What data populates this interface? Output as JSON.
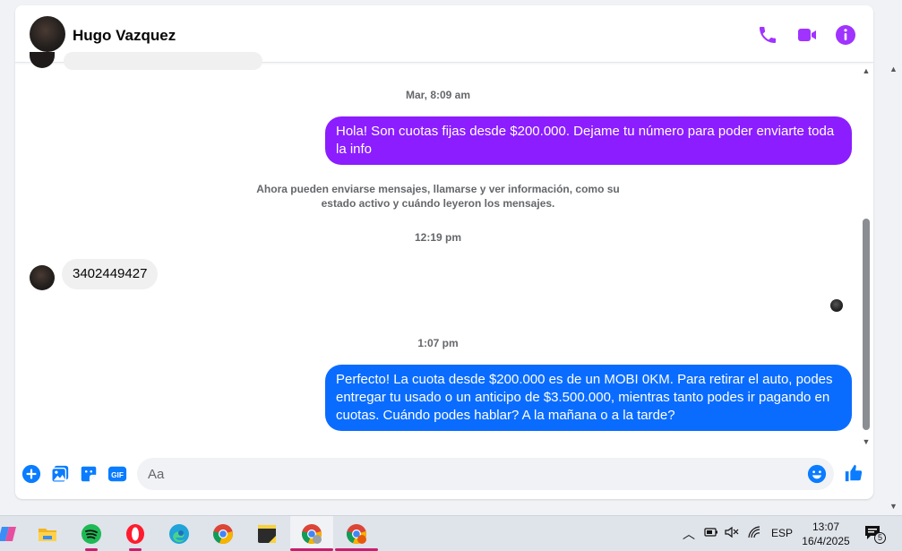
{
  "header": {
    "contact_name": "Hugo Vazquez",
    "icons": [
      "phone-icon",
      "video-call-icon",
      "info-icon"
    ],
    "accent_color": "#a033ff"
  },
  "messages": [
    {
      "type": "timestamp",
      "text": "Mar, 8:09 am"
    },
    {
      "type": "outgoing",
      "text": "Hola! Son cuotas fijas desde $200.000. Dejame tu número para poder enviarte toda la info",
      "color": "#8b1dff"
    },
    {
      "type": "system",
      "text": "Ahora pueden enviarse mensajes, llamarse y ver información, como su estado activo y cuándo leyeron los mensajes."
    },
    {
      "type": "timestamp",
      "text": "12:19 pm"
    },
    {
      "type": "incoming",
      "text": "3402449427"
    },
    {
      "type": "timestamp",
      "text": "1:07 pm"
    },
    {
      "type": "outgoing",
      "text": "Perfecto! La cuota desde $200.000 es de un MOBI 0KM. Para retirar el auto, podes entregar tu usado o un anticipo de $3.500.000, mientras tanto podes ir pagando en cuotas. Cuándo podes hablar? A la mañana o a la tarde?",
      "color": "#0a6cff"
    }
  ],
  "composer": {
    "placeholder": "Aa",
    "icons": [
      "add-icon",
      "photo-icon",
      "sticker-icon",
      "gif-icon",
      "emoji-icon",
      "like-icon"
    ],
    "gif_label": "GIF"
  },
  "taskbar": {
    "apps": [
      "copilot-icon",
      "file-explorer-icon",
      "spotify-icon",
      "opera-icon",
      "edge-icon",
      "chrome-icon",
      "sticky-notes-icon",
      "chrome-profile-icon",
      "chrome-profile-2-icon"
    ],
    "language": "ESP",
    "time": "13:07",
    "date": "16/4/2025",
    "notifications_count": "5"
  }
}
